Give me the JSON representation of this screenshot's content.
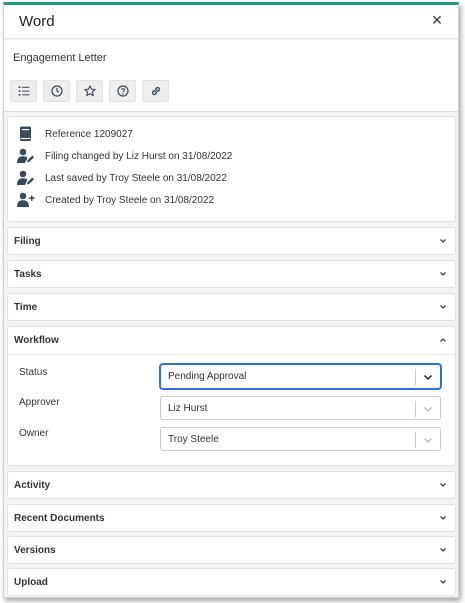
{
  "window": {
    "title": "Word",
    "close_glyph": "×"
  },
  "document": {
    "name": "Engagement Letter"
  },
  "toolbar": [
    {
      "icon": "checklist-icon"
    },
    {
      "icon": "clock-icon"
    },
    {
      "icon": "star-icon"
    },
    {
      "icon": "help-icon"
    },
    {
      "icon": "link-icon"
    }
  ],
  "info": {
    "reference": "Reference 1209027",
    "filing_changed": "Filing changed by Liz Hurst on 31/08/2022",
    "last_saved": "Last saved by Troy Steele on 31/08/2022",
    "created": "Created by Troy Steele on 31/08/2022"
  },
  "sections": {
    "filing": "Filing",
    "tasks": "Tasks",
    "time": "Time",
    "workflow": "Workflow",
    "activity": "Activity",
    "recent_documents": "Recent Documents",
    "versions": "Versions",
    "upload": "Upload"
  },
  "workflow": {
    "status_label": "Status",
    "status_value": "Pending Approval",
    "approver_label": "Approver",
    "approver_value": "Liz Hurst",
    "owner_label": "Owner",
    "owner_value": "Troy Steele"
  },
  "colors": {
    "accent": "#1f9a82",
    "focus": "#2f6fda",
    "icon": "#3a4a5a"
  }
}
